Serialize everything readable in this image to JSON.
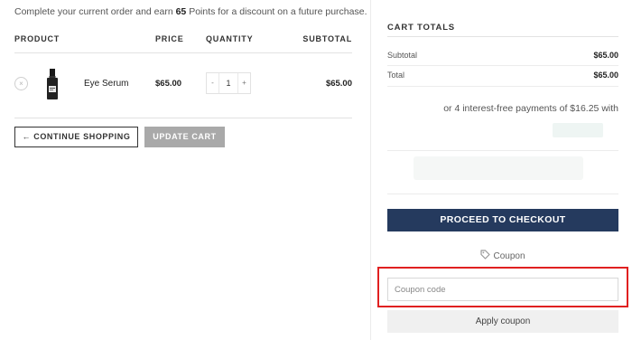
{
  "points_message": {
    "before": "Complete your current order and earn ",
    "points": "65",
    "after": " Points for a discount on a future purchase."
  },
  "cart": {
    "headers": {
      "product": "PRODUCT",
      "price": "PRICE",
      "quantity": "QUANTITY",
      "subtotal": "SUBTOTAL"
    },
    "items": [
      {
        "remove_icon": "×",
        "name": "Eye Serum",
        "price": "$65.00",
        "quantity": "1",
        "qty_minus": "-",
        "qty_plus": "+",
        "subtotal": "$65.00"
      }
    ],
    "continue_label": "← CONTINUE SHOPPING",
    "update_label": "UPDATE CART"
  },
  "totals": {
    "title": "CART TOTALS",
    "subtotal_label": "Subtotal",
    "subtotal_value": "$65.00",
    "total_label": "Total",
    "total_value": "$65.00",
    "installments": "or 4 interest-free payments of $16.25 with"
  },
  "checkout_label": "PROCEED TO CHECKOUT",
  "coupon": {
    "label": "Coupon",
    "placeholder": "Coupon code",
    "apply_label": "Apply coupon"
  },
  "colors": {
    "checkout_bg": "#253a5e",
    "update_bg": "#a9a9a9",
    "highlight": "#e02020"
  }
}
